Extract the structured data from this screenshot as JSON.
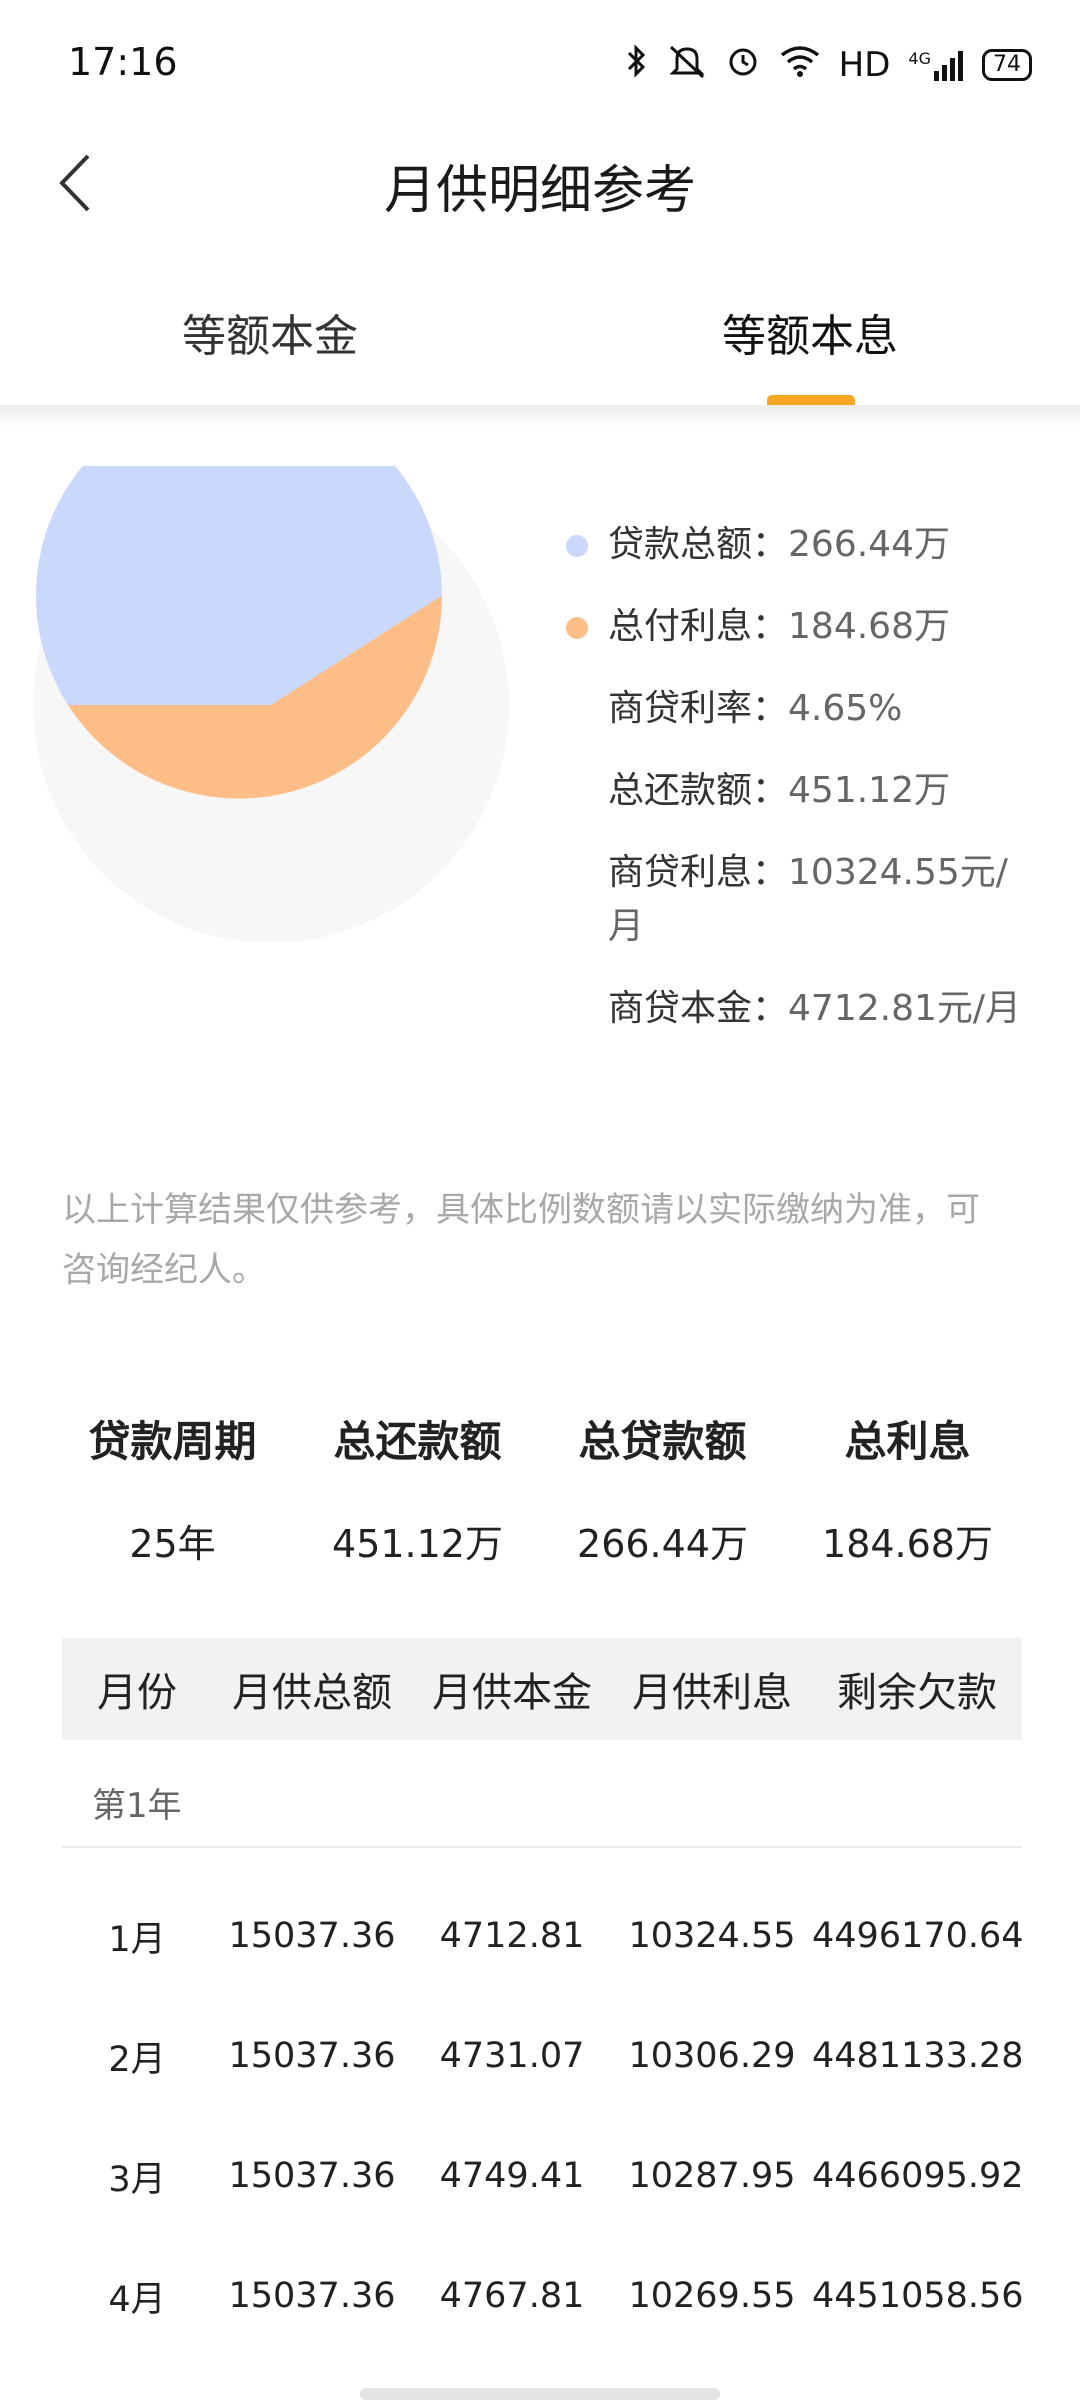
{
  "status": {
    "time": "17:16",
    "network": "HD",
    "signal": "4G",
    "battery": "74"
  },
  "nav": {
    "title": "月供明细参考"
  },
  "tabs": [
    {
      "label": "等额本金",
      "active": false
    },
    {
      "label": "等额本息",
      "active": true
    }
  ],
  "colors": {
    "accent": "#f5a623",
    "loan": "#c9d8fb",
    "interest": "#fdbd87"
  },
  "pie": {
    "loan_wan": 266.44,
    "interest_wan": 184.68
  },
  "legend": {
    "loan_total": {
      "label": "贷款总额：",
      "value": "266.44万"
    },
    "interest_total": {
      "label": "总付利息：",
      "value": "184.68万"
    },
    "rate": {
      "label": "商贷利率：",
      "value": "4.65%"
    },
    "repay_total": {
      "label": "总还款额：",
      "value": "451.12万"
    },
    "monthly_interest": {
      "label": "商贷利息：",
      "value": "10324.55元/月"
    },
    "monthly_principal": {
      "label": "商贷本金：",
      "value": "4712.81元/月"
    }
  },
  "disclaimer": "以上计算结果仅供参考，具体比例数额请以实际缴纳为准，可咨询经纪人。",
  "summary": {
    "period": {
      "label": "贷款周期",
      "value": "25年"
    },
    "repay": {
      "label": "总还款额",
      "value": "451.12万"
    },
    "loan": {
      "label": "总贷款额",
      "value": "266.44万"
    },
    "interest": {
      "label": "总利息",
      "value": "184.68万"
    }
  },
  "table": {
    "headers": [
      "月份",
      "月供总额",
      "月供本金",
      "月供利息",
      "剩余欠款"
    ],
    "year_label": "第1年",
    "rows": [
      [
        "1月",
        "15037.36",
        "4712.81",
        "10324.55",
        "4496170.64"
      ],
      [
        "2月",
        "15037.36",
        "4731.07",
        "10306.29",
        "4481133.28"
      ],
      [
        "3月",
        "15037.36",
        "4749.41",
        "10287.95",
        "4466095.92"
      ],
      [
        "4月",
        "15037.36",
        "4767.81",
        "10269.55",
        "4451058.56"
      ]
    ]
  }
}
